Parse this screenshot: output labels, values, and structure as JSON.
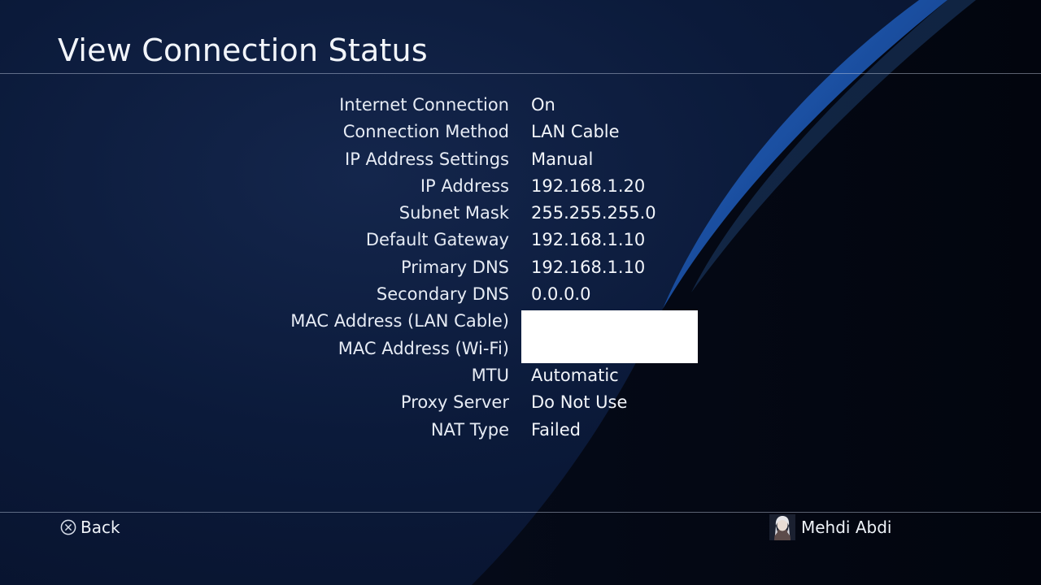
{
  "header": {
    "title": "View Connection Status"
  },
  "status": [
    {
      "label": "Internet Connection",
      "value": "On"
    },
    {
      "label": "Connection Method",
      "value": "LAN Cable"
    },
    {
      "label": "IP Address Settings",
      "value": "Manual"
    },
    {
      "label": "IP Address",
      "value": "192.168.1.20"
    },
    {
      "label": "Subnet Mask",
      "value": "255.255.255.0"
    },
    {
      "label": "Default Gateway",
      "value": "192.168.1.10"
    },
    {
      "label": "Primary DNS",
      "value": "192.168.1.10"
    },
    {
      "label": "Secondary DNS",
      "value": "0.0.0.0"
    },
    {
      "label": "MAC Address (LAN Cable)",
      "value": ""
    },
    {
      "label": "MAC Address (Wi-Fi)",
      "value": ""
    },
    {
      "label": "MTU",
      "value": "Automatic"
    },
    {
      "label": "Proxy Server",
      "value": "Do Not Use"
    },
    {
      "label": "NAT Type",
      "value": "Failed"
    }
  ],
  "footer": {
    "back_label": "Back",
    "back_icon": "cross-button-icon",
    "user_name": "Mehdi Abdi",
    "avatar_icon": "user-avatar"
  },
  "colors": {
    "background": "#0a1530",
    "accent_wave": "#1e5bb8",
    "text": "#f2f5fa",
    "redaction": "#ffffff"
  }
}
